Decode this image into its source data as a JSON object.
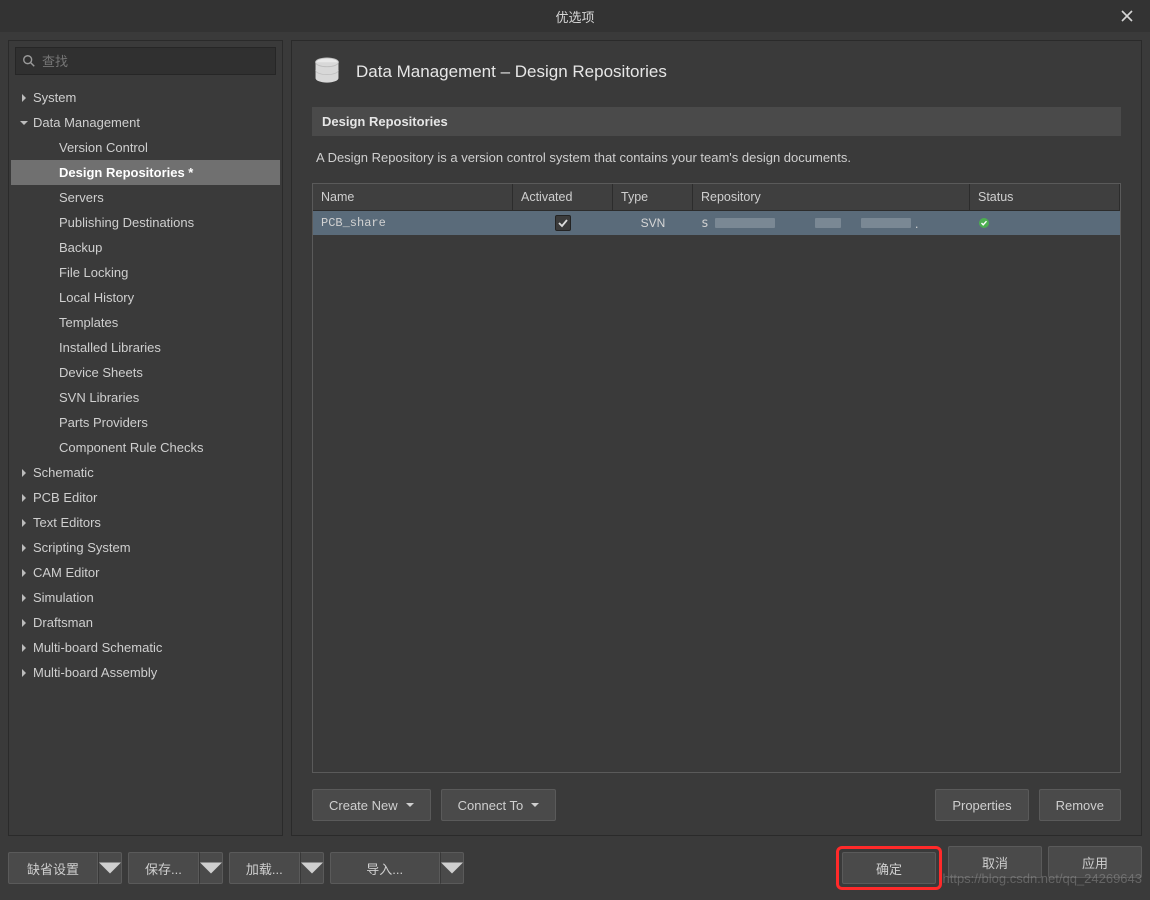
{
  "window": {
    "title": "优选项",
    "close_icon": "close"
  },
  "search": {
    "placeholder": "查找"
  },
  "tree": {
    "items": [
      {
        "label": "System",
        "expanded": false,
        "level": 0
      },
      {
        "label": "Data Management",
        "expanded": true,
        "level": 0
      },
      {
        "label": "Version Control",
        "level": 1
      },
      {
        "label": "Design Repositories *",
        "level": 1,
        "selected": true
      },
      {
        "label": "Servers",
        "level": 1
      },
      {
        "label": "Publishing Destinations",
        "level": 1
      },
      {
        "label": "Backup",
        "level": 1
      },
      {
        "label": "File Locking",
        "level": 1
      },
      {
        "label": "Local History",
        "level": 1
      },
      {
        "label": "Templates",
        "level": 1
      },
      {
        "label": "Installed Libraries",
        "level": 1
      },
      {
        "label": "Device Sheets",
        "level": 1
      },
      {
        "label": "SVN Libraries",
        "level": 1
      },
      {
        "label": "Parts Providers",
        "level": 1
      },
      {
        "label": "Component Rule Checks",
        "level": 1
      },
      {
        "label": "Schematic",
        "expanded": false,
        "level": 0
      },
      {
        "label": "PCB Editor",
        "expanded": false,
        "level": 0
      },
      {
        "label": "Text Editors",
        "expanded": false,
        "level": 0
      },
      {
        "label": "Scripting System",
        "expanded": false,
        "level": 0
      },
      {
        "label": "CAM Editor",
        "expanded": false,
        "level": 0
      },
      {
        "label": "Simulation",
        "expanded": false,
        "level": 0
      },
      {
        "label": "Draftsman",
        "expanded": false,
        "level": 0
      },
      {
        "label": "Multi-board Schematic",
        "expanded": false,
        "level": 0
      },
      {
        "label": "Multi-board Assembly",
        "expanded": false,
        "level": 0
      }
    ]
  },
  "main": {
    "heading": "Data Management – Design Repositories",
    "section": "Design Repositories",
    "description": "A Design Repository is a version control system that contains your team's design documents.",
    "columns": {
      "name": "Name",
      "activated": "Activated",
      "type": "Type",
      "repository": "Repository",
      "status": "Status"
    },
    "rows": [
      {
        "name": "PCB_share",
        "activated": true,
        "type": "SVN",
        "repository_redacted": true,
        "status": "ok"
      }
    ],
    "buttons": {
      "create_new": "Create New",
      "connect_to": "Connect To",
      "properties": "Properties",
      "remove": "Remove"
    }
  },
  "footer": {
    "defaults": "缺省设置",
    "save": "保存...",
    "load": "加载...",
    "import": "导入...",
    "ok": "确定",
    "cancel": "取消",
    "apply": "应用"
  },
  "watermark": "https://blog.csdn.net/qq_24269643"
}
